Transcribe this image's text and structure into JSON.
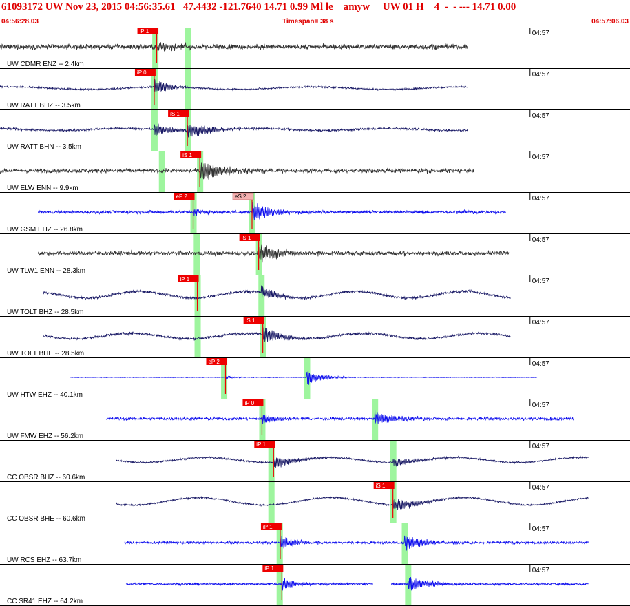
{
  "header": {
    "title": "61093172 UW Nov 23, 2015 04:56:35.61   47.4432 -121.7640 14.71 0.99 Ml le    amyw     UW 01 H    4  -  - --- 14.71 0.00",
    "start_time": "04:56:28.03",
    "timespan_label": "Timespan=  38 s",
    "end_time": "04:57:06.03"
  },
  "colors": {
    "header_text": "#e00000",
    "trace_dark": "#333333",
    "trace_navy": "#1a1a66",
    "trace_blue": "#1010ee",
    "pick_red": "#ee0000",
    "pick_pink": "#f4b0b0",
    "pick_window": "#9ef59e"
  },
  "chart_data": {
    "type": "seismogram",
    "x_start": "04:56:28.03",
    "x_end": "04:57:06.03",
    "timespan_s": 38,
    "time_tick_label": "04:57",
    "time_tick_offset_s": 31.97,
    "traces": [
      {
        "label": "UW CDMR ENZ -- 2.4km",
        "color": "dark",
        "start": 0.0,
        "end": 28.2,
        "amp": 0.11,
        "style": "noise",
        "picks": [
          {
            "label": "iP 1",
            "t": 9.45,
            "kind": "red"
          }
        ],
        "windows": [
          9.35,
          11.3
        ],
        "bursts": [
          [
            9.45,
            0.24,
            2.5
          ]
        ]
      },
      {
        "label": "UW RATT BHZ -- 3.5km",
        "color": "navy",
        "start": 0.0,
        "end": 28.2,
        "amp": 0.04,
        "style": "wave",
        "wave_amp": 0.06,
        "wave_period": 9,
        "picks": [
          {
            "label": "iP 0",
            "t": 9.3,
            "kind": "red"
          }
        ],
        "windows": [
          9.3,
          11.3
        ],
        "bursts": [
          [
            9.3,
            0.42,
            1.8
          ]
        ]
      },
      {
        "label": "UW RATT BHN -- 3.5km",
        "color": "navy",
        "start": 0.0,
        "end": 28.2,
        "amp": 0.05,
        "style": "wave",
        "wave_amp": 0.05,
        "wave_period": 8,
        "picks": [
          {
            "label": "iS 1",
            "t": 11.3,
            "kind": "red"
          }
        ],
        "windows": [
          9.3,
          11.3
        ],
        "bursts": [
          [
            9.3,
            0.35,
            2
          ],
          [
            11.3,
            0.4,
            3
          ]
        ]
      },
      {
        "label": "UW ELW ENN -- 9.9km",
        "color": "dark",
        "start": 0.0,
        "end": 28.6,
        "amp": 0.09,
        "style": "noise",
        "picks": [
          {
            "label": "iS 1",
            "t": 12.05,
            "kind": "red"
          }
        ],
        "windows": [
          9.75,
          12.05
        ],
        "bursts": [
          [
            12.05,
            0.5,
            3
          ]
        ]
      },
      {
        "label": "UW GSM EHZ -- 26.8km",
        "color": "blue",
        "start": 2.3,
        "end": 30.5,
        "amp": 0.07,
        "style": "noise",
        "picks": [
          {
            "label": "eP 2",
            "t": 11.65,
            "kind": "red"
          },
          {
            "label": "eS 2",
            "t": 15.2,
            "kind": "pink"
          }
        ],
        "windows": [
          11.65,
          15.2
        ],
        "bursts": [
          [
            11.65,
            0.2,
            1.5
          ],
          [
            15.2,
            0.5,
            2.5
          ]
        ]
      },
      {
        "label": "UW TLW1 ENN -- 28.3km",
        "color": "dark",
        "start": 2.3,
        "end": 30.7,
        "amp": 0.1,
        "style": "noise",
        "picks": [
          {
            "label": "iS 1",
            "t": 15.6,
            "kind": "red"
          }
        ],
        "windows": [
          11.85,
          15.6
        ],
        "bursts": [
          [
            15.6,
            0.45,
            3
          ]
        ]
      },
      {
        "label": "UW TOLT BHZ -- 28.5km",
        "color": "navy",
        "start": 2.6,
        "end": 30.8,
        "amp": 0.06,
        "style": "wave",
        "wave_amp": 0.16,
        "wave_period": 6.5,
        "picks": [
          {
            "label": "iP 1",
            "t": 11.9,
            "kind": "red"
          }
        ],
        "windows": [
          11.9,
          15.75
        ],
        "bursts": [
          [
            15.75,
            0.35,
            2.5
          ]
        ]
      },
      {
        "label": "UW TOLT BHE -- 28.5km",
        "color": "navy",
        "start": 2.6,
        "end": 30.8,
        "amp": 0.06,
        "style": "wave",
        "wave_amp": 0.13,
        "wave_period": 7,
        "picks": [
          {
            "label": "iS 1",
            "t": 15.85,
            "kind": "red"
          }
        ],
        "windows": [
          11.9,
          15.85
        ],
        "bursts": [
          [
            15.85,
            0.4,
            2.5
          ]
        ]
      },
      {
        "label": "UW HTW EHZ -- 40.1km",
        "color": "blue",
        "start": 4.2,
        "end": 32.4,
        "amp": 0.015,
        "style": "noise",
        "picks": [
          {
            "label": "eP 2",
            "t": 13.6,
            "kind": "red"
          }
        ],
        "windows": [
          13.5,
          18.5
        ],
        "bursts": [
          [
            13.6,
            0.08,
            1.5
          ],
          [
            18.5,
            0.38,
            2
          ]
        ]
      },
      {
        "label": "UW FMW EHZ -- 56.2km",
        "color": "blue",
        "start": 6.4,
        "end": 34.6,
        "amp": 0.07,
        "style": "noise",
        "picks": [
          {
            "label": "iP 0",
            "t": 15.8,
            "kind": "red"
          }
        ],
        "windows": [
          15.8,
          22.6
        ],
        "bursts": [
          [
            15.8,
            0.25,
            2
          ],
          [
            22.6,
            0.35,
            3
          ]
        ]
      },
      {
        "label": "CC OBSR BHZ -- 60.6km",
        "color": "navy",
        "start": 7.0,
        "end": 35.5,
        "amp": 0.04,
        "style": "wave",
        "wave_amp": 0.12,
        "wave_period": 7.5,
        "picks": [
          {
            "label": "iP 1",
            "t": 16.5,
            "kind": "red"
          }
        ],
        "windows": [
          16.35,
          23.7
        ],
        "bursts": [
          [
            16.5,
            0.3,
            3
          ],
          [
            23.7,
            0.25,
            3
          ]
        ]
      },
      {
        "label": "CC OBSR BHE -- 60.6km",
        "color": "navy",
        "start": 7.0,
        "end": 35.5,
        "amp": 0.04,
        "style": "wave",
        "wave_amp": 0.18,
        "wave_period": 8,
        "picks": [
          {
            "label": "iS 1",
            "t": 23.7,
            "kind": "red"
          }
        ],
        "windows": [
          16.35,
          23.7
        ],
        "bursts": [
          [
            23.7,
            0.35,
            3
          ]
        ]
      },
      {
        "label": "UW RCS EHZ -- 63.7km",
        "color": "blue",
        "start": 7.5,
        "end": 35.5,
        "amp": 0.06,
        "style": "noise",
        "picks": [
          {
            "label": "iP 1",
            "t": 16.9,
            "kind": "red"
          }
        ],
        "windows": [
          16.85,
          24.4
        ],
        "bursts": [
          [
            16.9,
            0.35,
            2
          ],
          [
            24.4,
            0.4,
            2.5
          ]
        ]
      },
      {
        "label": "CC SR41 EHZ -- 64.2km",
        "color": "blue",
        "start": 7.6,
        "end": 35.5,
        "amp": 0.05,
        "style": "noise",
        "gap": [
          22.5,
          23.6
        ],
        "picks": [
          {
            "label": "iP 1",
            "t": 17.0,
            "kind": "red"
          }
        ],
        "windows": [
          16.85,
          24.6
        ],
        "bursts": [
          [
            17.0,
            0.3,
            2
          ],
          [
            24.6,
            0.38,
            3
          ]
        ]
      }
    ]
  }
}
